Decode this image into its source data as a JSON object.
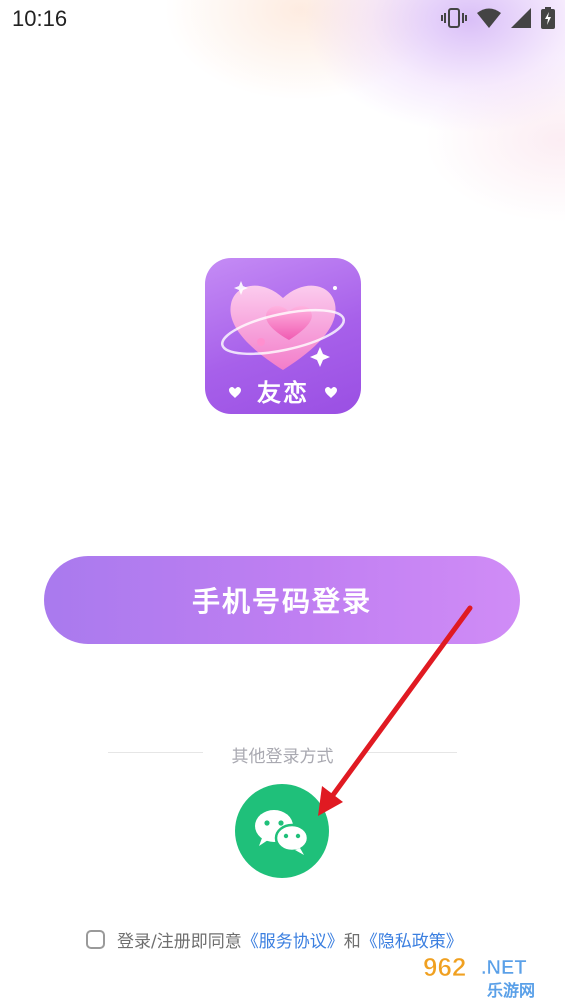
{
  "status_bar": {
    "time": "10:16",
    "icons": [
      "vibrate-icon",
      "wifi-icon",
      "signal-icon",
      "battery-charging-icon"
    ]
  },
  "app": {
    "logo_text": "友恋"
  },
  "login": {
    "phone_button": "手机号码登录",
    "other_methods_label": "其他登录方式",
    "wechat_icon": "wechat-icon"
  },
  "agreement": {
    "checked": false,
    "prefix": "登录/注册即同意",
    "service_link": "《服务协议》",
    "conjunction": "和",
    "privacy_link": "《隐私政策》"
  },
  "watermark": {
    "number": "962",
    "suffix": ".NET",
    "site": "乐游网"
  },
  "colors": {
    "primary_gradient_start": "#a97aee",
    "primary_gradient_end": "#d08cf6",
    "wechat_green": "#1fc07a",
    "link_blue": "#3b7fe0",
    "annotation_arrow": "#e01a22"
  }
}
